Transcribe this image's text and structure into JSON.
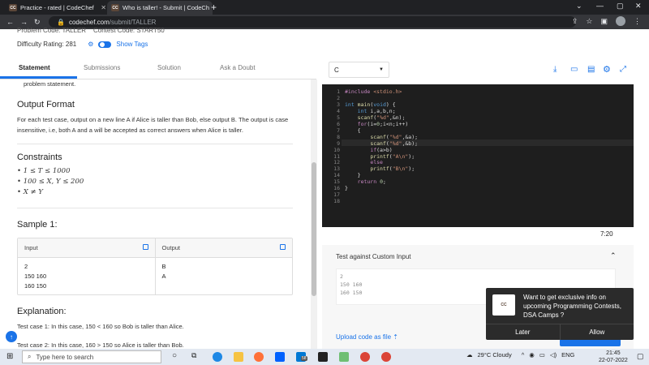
{
  "browser": {
    "tabs": [
      {
        "title": "Practice - rated | CodeChef",
        "favicon": "CC"
      },
      {
        "title": "Who is taller! - Submit | CodeCh",
        "favicon": "CC"
      }
    ],
    "url_host": "codechef.com",
    "url_path": "/submit/TALLER"
  },
  "problem": {
    "code_label": "Problem Code: TALLER",
    "contest_label": "Contest Code: START50",
    "difficulty": "Difficulty Rating: 281",
    "show_tags": "Show Tags"
  },
  "left_tabs": [
    "Statement",
    "Submissions",
    "Solution",
    "Ask a Doubt"
  ],
  "statement": {
    "intro_tail": "problem statement.",
    "output_heading": "Output Format",
    "output_text": "For each test case, output on a new line A if Alice is taller than Bob, else output B. The output is case insensitive, i.e, both A and a will be accepted as correct answers when Alice is taller.",
    "constraints_heading": "Constraints",
    "constraints": [
      "1 ≤ T ≤ 1000",
      "100 ≤ X, Y ≤ 200",
      "X ≠ Y"
    ],
    "sample_heading": "Sample 1:",
    "input_label": "Input",
    "output_label": "Output",
    "input_lines": [
      "2",
      "150 160",
      "160 150"
    ],
    "output_lines": [
      "B",
      "A"
    ],
    "explanation_heading": "Explanation:",
    "tc1": "Test case 1: In this case, 150 < 160 so Bob is taller than Alice.",
    "tc2": "Test case 2: In this case, 160 > 150 so Alice is taller than Bob."
  },
  "editor": {
    "language": "C",
    "line_numbers": [
      "1",
      "2",
      "3",
      "4",
      "5",
      "6",
      "7",
      "8",
      "9",
      "10",
      "11",
      "12",
      "13",
      "14",
      "15",
      "16",
      "17",
      "18"
    ],
    "time": "7:20"
  },
  "custom": {
    "label": "Test against Custom Input",
    "input": "2\n150 160\n160 150",
    "upload": "Upload code as file"
  },
  "toast": {
    "message": "Want to get exclusive info on upcoming Programming Contests, DSA Camps ?",
    "later": "Later",
    "allow": "Allow",
    "logo": "CC"
  },
  "taskbar": {
    "search": "Type here to search",
    "weather": "29°C  Cloudy",
    "lang": "ENG",
    "time": "21:45",
    "date": "22-07-2022",
    "badge": "58"
  }
}
